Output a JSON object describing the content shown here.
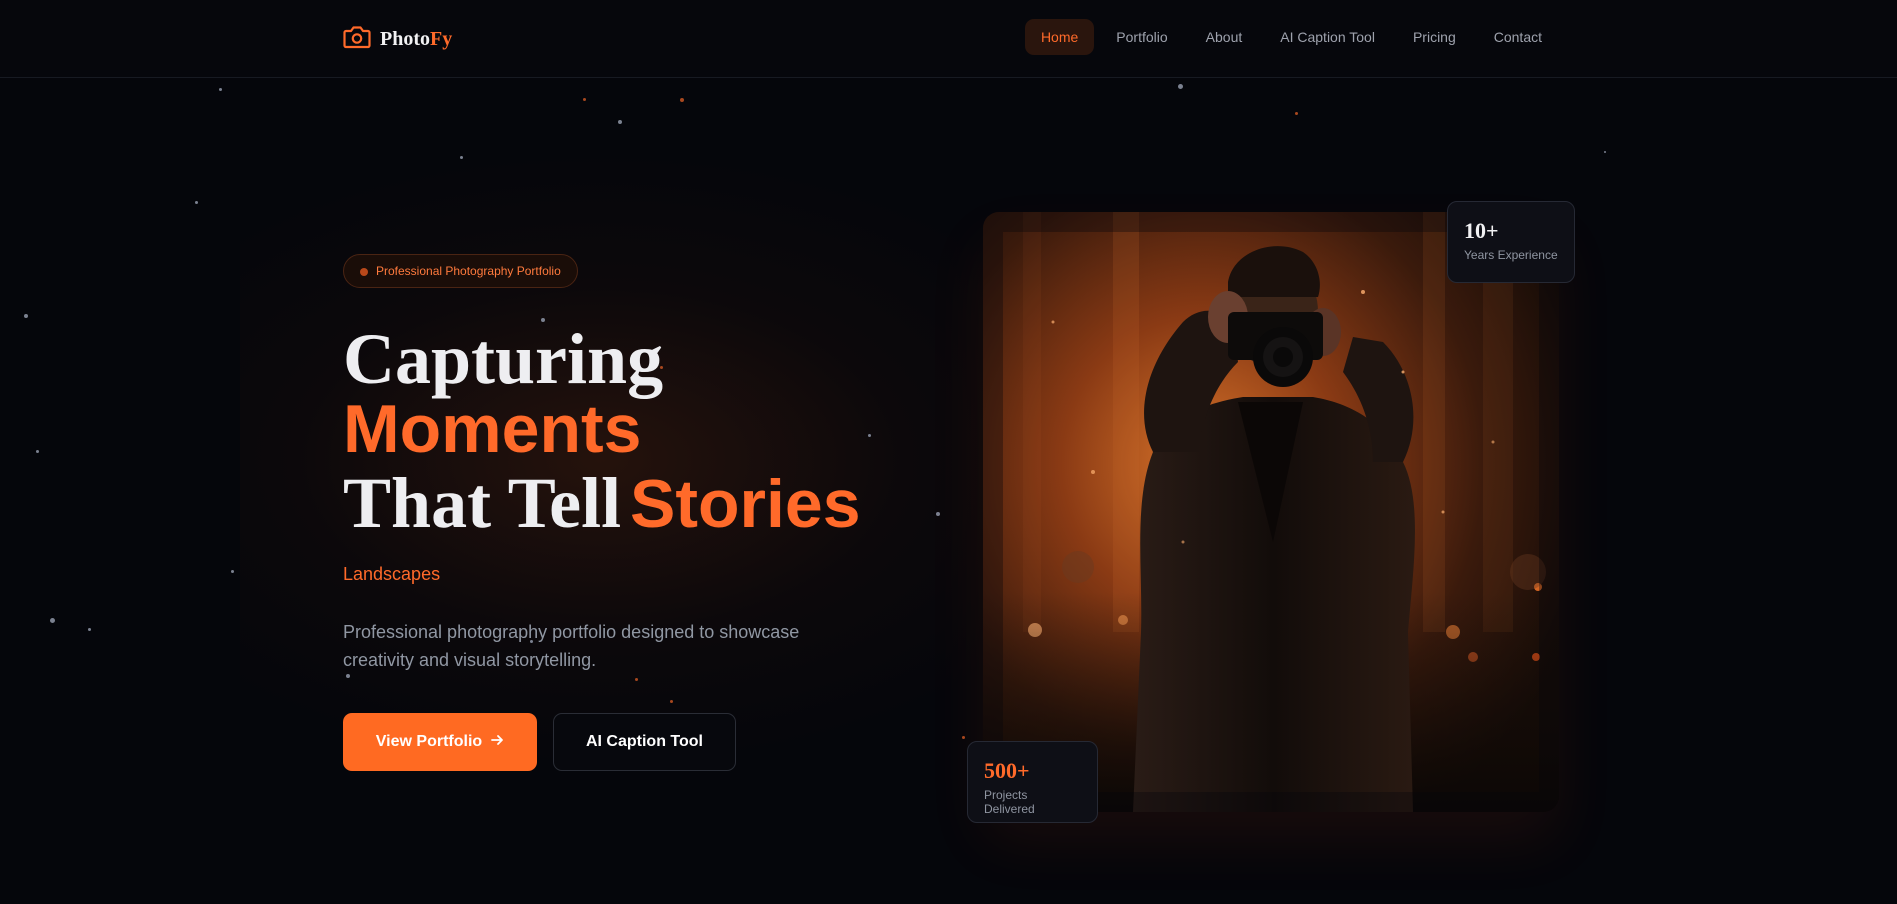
{
  "brand": {
    "name_part1": "Photo",
    "name_part2": "Fy",
    "icon": "camera-icon"
  },
  "nav": {
    "items": [
      {
        "label": "Home",
        "active": true
      },
      {
        "label": "Portfolio",
        "active": false
      },
      {
        "label": "About",
        "active": false
      },
      {
        "label": "AI Caption Tool",
        "active": false
      },
      {
        "label": "Pricing",
        "active": false
      },
      {
        "label": "Contact",
        "active": false
      }
    ]
  },
  "hero": {
    "badge": "Professional Photography Portfolio",
    "title": {
      "line1": "Capturing",
      "line2": "Moments",
      "line3_serif": "That Tell",
      "line3_accent": "Stories"
    },
    "typed_word": "Landscapes",
    "description": "Professional photography portfolio designed to showcase creativity and visual storytelling.",
    "primary_button": "View Portfolio",
    "primary_button_icon": "arrow-right-icon",
    "secondary_button": "AI Caption Tool"
  },
  "stats": {
    "years": {
      "value": "10+",
      "label": "Years Experience"
    },
    "projects": {
      "value": "500+",
      "label": "Projects Delivered"
    }
  },
  "colors": {
    "accent": "#ff6a2a",
    "background": "#05060b",
    "card": "#0e0f16"
  }
}
